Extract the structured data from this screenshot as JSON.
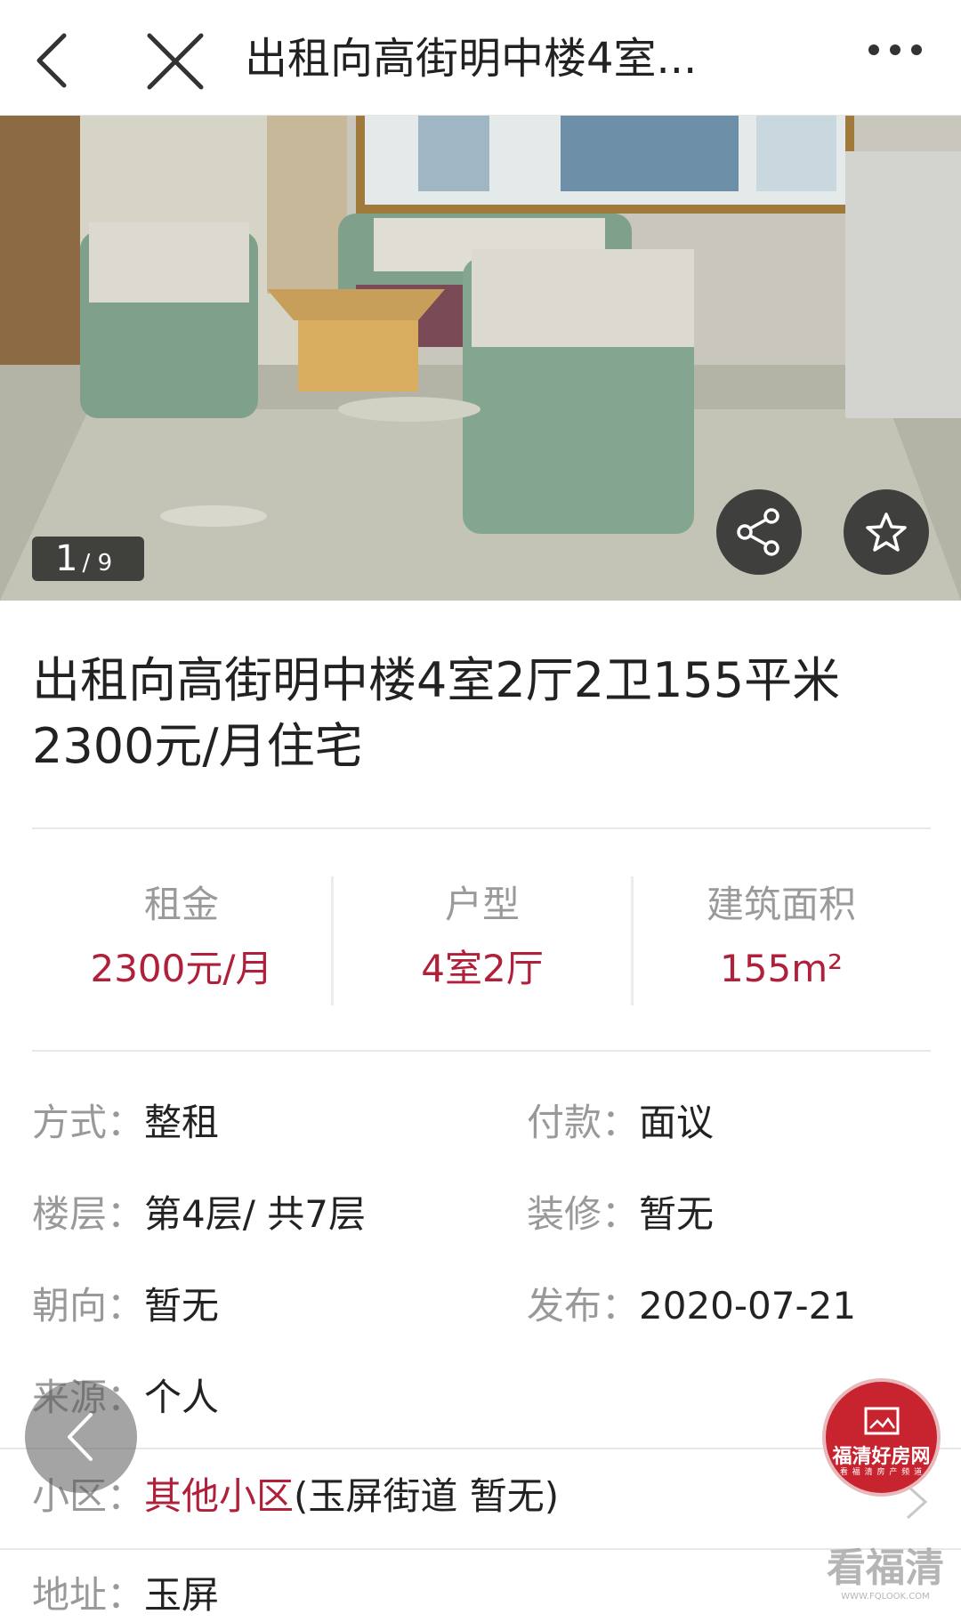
{
  "header": {
    "title": "出租向高街明中楼4室..."
  },
  "gallery": {
    "current": "1",
    "total": "/ 9"
  },
  "listing": {
    "title": "出租向高街明中楼4室2厅2卫155平米2300元/月住宅"
  },
  "stats": [
    {
      "label": "租金",
      "value": "2300元/月"
    },
    {
      "label": "户型",
      "value": "4室2厅"
    },
    {
      "label": "建筑面积",
      "value": "155m²"
    }
  ],
  "details": {
    "mode": {
      "label": "方式：",
      "value": "整租"
    },
    "payment": {
      "label": "付款：",
      "value": "面议"
    },
    "floor": {
      "label": "楼层：",
      "value": "第4层/ 共7层"
    },
    "decoration": {
      "label": "装修：",
      "value": "暂无"
    },
    "orientation": {
      "label": "朝向：",
      "value": "暂无"
    },
    "published": {
      "label": "发布：",
      "value": "2020-07-21"
    },
    "source": {
      "label": "来源：",
      "value": "个人"
    }
  },
  "community": {
    "label": "小区：",
    "link": "其他小区",
    "detail": "(玉屏街道 暂无)"
  },
  "address": {
    "label": "地址：",
    "value": "玉屏"
  },
  "brand": {
    "name": "福清好房网",
    "sub": "看 福 清 房 产 频 道"
  },
  "watermark": {
    "main": "看福清",
    "sub": "WWW.FQLOOK.COM"
  },
  "colors": {
    "accent": "#b0203a",
    "brand_red": "#c8242f"
  }
}
